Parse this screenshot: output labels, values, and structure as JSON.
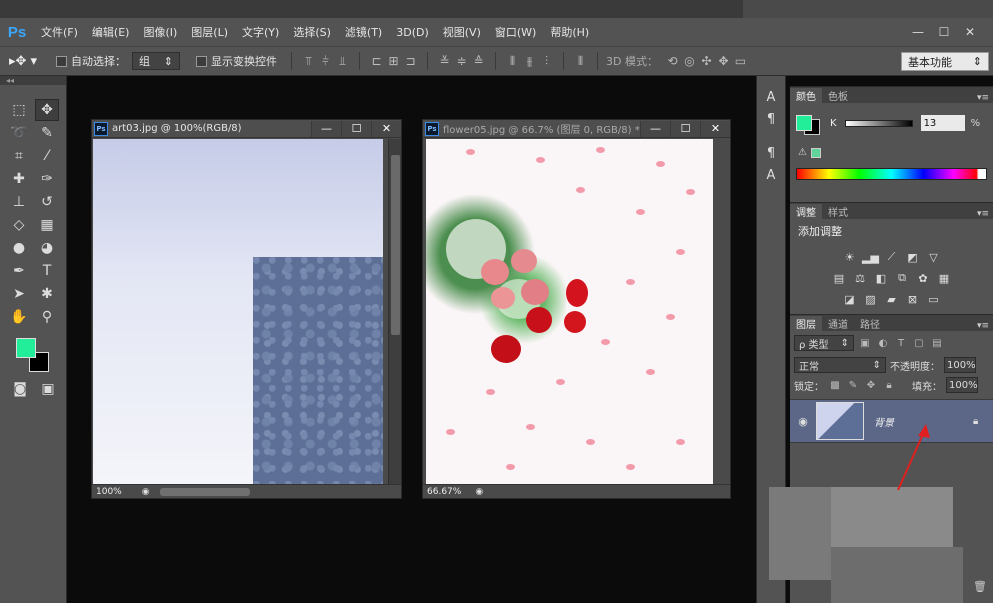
{
  "app": {
    "logo": "Ps"
  },
  "menu": [
    "文件(F)",
    "编辑(E)",
    "图像(I)",
    "图层(L)",
    "文字(Y)",
    "选择(S)",
    "滤镜(T)",
    "3D(D)",
    "视图(V)",
    "窗口(W)",
    "帮助(H)"
  ],
  "window_controls": [
    "—",
    "☐",
    "✕"
  ],
  "options": {
    "auto_select_label": "自动选择：",
    "auto_select_value": "组",
    "transform_label": "显示变换控件",
    "mode_3d_label": "3D 模式：",
    "workspace": "基本功能"
  },
  "documents": [
    {
      "title": "art03.jpg @ 100%(RGB/8)",
      "zoom": "100%"
    },
    {
      "title": "flower05.jpg @ 66.7% (图层 0, RGB/8) *",
      "zoom": "66.67%"
    }
  ],
  "doc_buttons": [
    "—",
    "☐",
    "✕"
  ],
  "color_panel": {
    "tabs": [
      "颜色",
      "色板"
    ],
    "channel_label": "K",
    "value": "13",
    "unit": "%",
    "colors": {
      "foreground": "#22ee99",
      "background": "#000000"
    }
  },
  "adjust_panel": {
    "tabs": [
      "调整",
      "样式"
    ],
    "title": "添加调整"
  },
  "layers_panel": {
    "tabs": [
      "图层",
      "通道",
      "路径"
    ],
    "filter": "ρ 类型",
    "blend_mode": "正常",
    "opacity_label": "不透明度：",
    "opacity_value": "100%",
    "lock_label": "锁定：",
    "fill_label": "填充：",
    "fill_value": "100%",
    "layer_name": "背景"
  }
}
